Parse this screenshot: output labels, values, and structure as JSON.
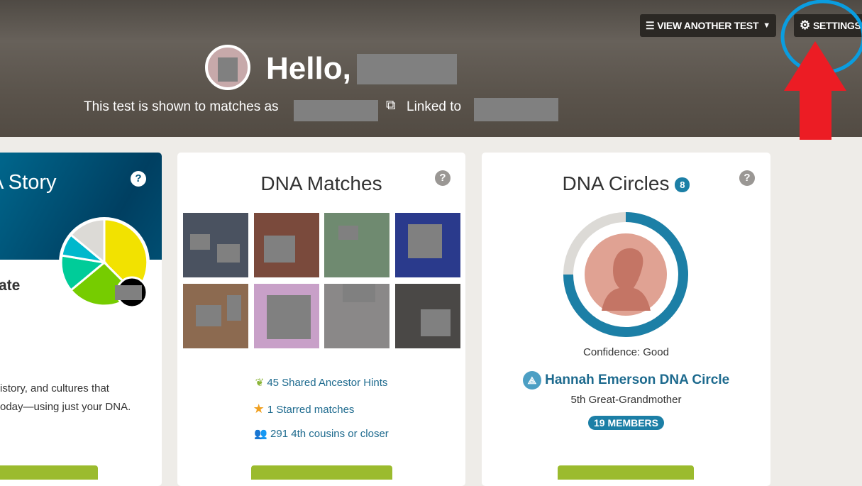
{
  "header": {
    "view_another_test": "VIEW ANOTHER TEST",
    "settings": "SETTINGS",
    "greeting": "Hello,",
    "shown_as": "This test is shown to matches as",
    "linked_to": "Linked to"
  },
  "story_card": {
    "title_partial": "A Story",
    "subtitle_partial": "ate",
    "text_line1": "istory, and cultures that",
    "text_line2": "oday—using just your DNA.",
    "help": "?"
  },
  "matches_card": {
    "title": "DNA Matches",
    "help": "?",
    "links": [
      {
        "icon": "leaf-icon",
        "label": "45 Shared Ancestor Hints"
      },
      {
        "icon": "star-icon",
        "label": "1 Starred matches"
      },
      {
        "icon": "people-icon",
        "label": "291 4th cousins or closer"
      }
    ]
  },
  "circles_card": {
    "title": "DNA Circles",
    "count": "8",
    "help": "?",
    "confidence": "Confidence: Good",
    "confidence_level": 0.75,
    "circle_name": "Hannah Emerson DNA Circle",
    "relationship": "5th Great-Grandmother",
    "members": "19 MEMBERS"
  },
  "colors": {
    "accent": "#1d6a8e",
    "badge": "#1c7fa6",
    "green_button": "#9bbb2e",
    "annotation_circle": "#0a9de0",
    "annotation_arrow": "#ec1c24"
  }
}
